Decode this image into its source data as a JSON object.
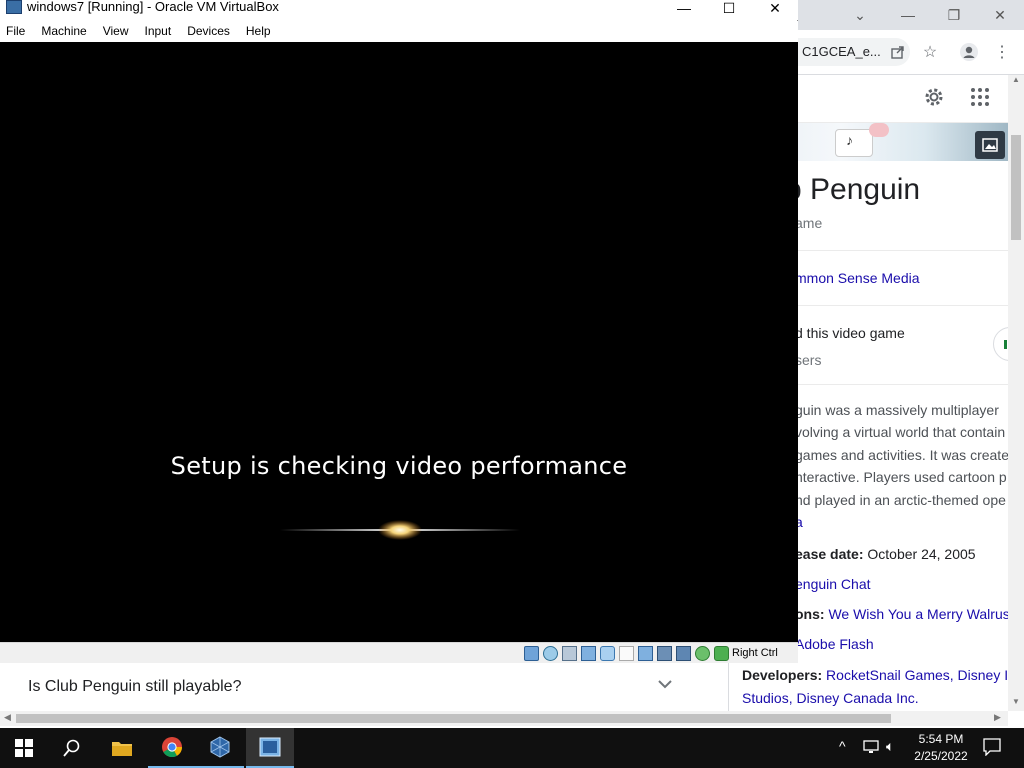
{
  "virtualbox": {
    "window_title": "windows7 [Running] - Oracle VM VirtualBox",
    "menu": [
      "File",
      "Machine",
      "View",
      "Input",
      "Devices",
      "Help"
    ],
    "vm_screen": {
      "setup_text": "Setup is checking video performance"
    },
    "statusbar": {
      "icons": [
        "hard-disk-icon",
        "optical-drive-icon",
        "audio-icon",
        "network-icon",
        "usb-icon",
        "shared-folder-icon",
        "display-icon",
        "video-capture-icon",
        "cpu-icon",
        "mouse-integration-icon",
        "keyboard-icon"
      ],
      "host_key": "Right Ctrl"
    }
  },
  "browser": {
    "omnibox_text": "C1GCEA_e...",
    "knowledge_panel": {
      "title_fragment": "b Penguin",
      "subtitle_fragment": "ame",
      "rating_source": "mmon Sense Media",
      "liked_text": "d this video game",
      "liked_sub": "sers",
      "description_lines": [
        "guin was a massively multiplayer",
        "volving a virtual world that contain",
        "games and activities. It was create",
        "nteractive. Players used cartoon p",
        "nd played in an arctic-themed ope"
      ],
      "description_link": "a",
      "release_label": "ease date:",
      "release_value": "October 24, 2005",
      "successor_link": "enguin Chat",
      "versions_label": "ons:",
      "versions_link": "We Wish You a Merry Walrus",
      "engine_link": "Adobe Flash",
      "developers_label": "Developers:",
      "developers_line1": "RocketSnail Games, Disney In",
      "developers_line2": "Studios, Disney Canada Inc."
    },
    "faq": {
      "question": "Is Club Penguin still playable?"
    }
  },
  "taskbar": {
    "clock_time": "5:54 PM",
    "clock_date": "2/25/2022"
  },
  "colors": {
    "taskbar_bg": "#101010",
    "link_blue": "#1a0dab",
    "vm_bg": "#000000"
  }
}
